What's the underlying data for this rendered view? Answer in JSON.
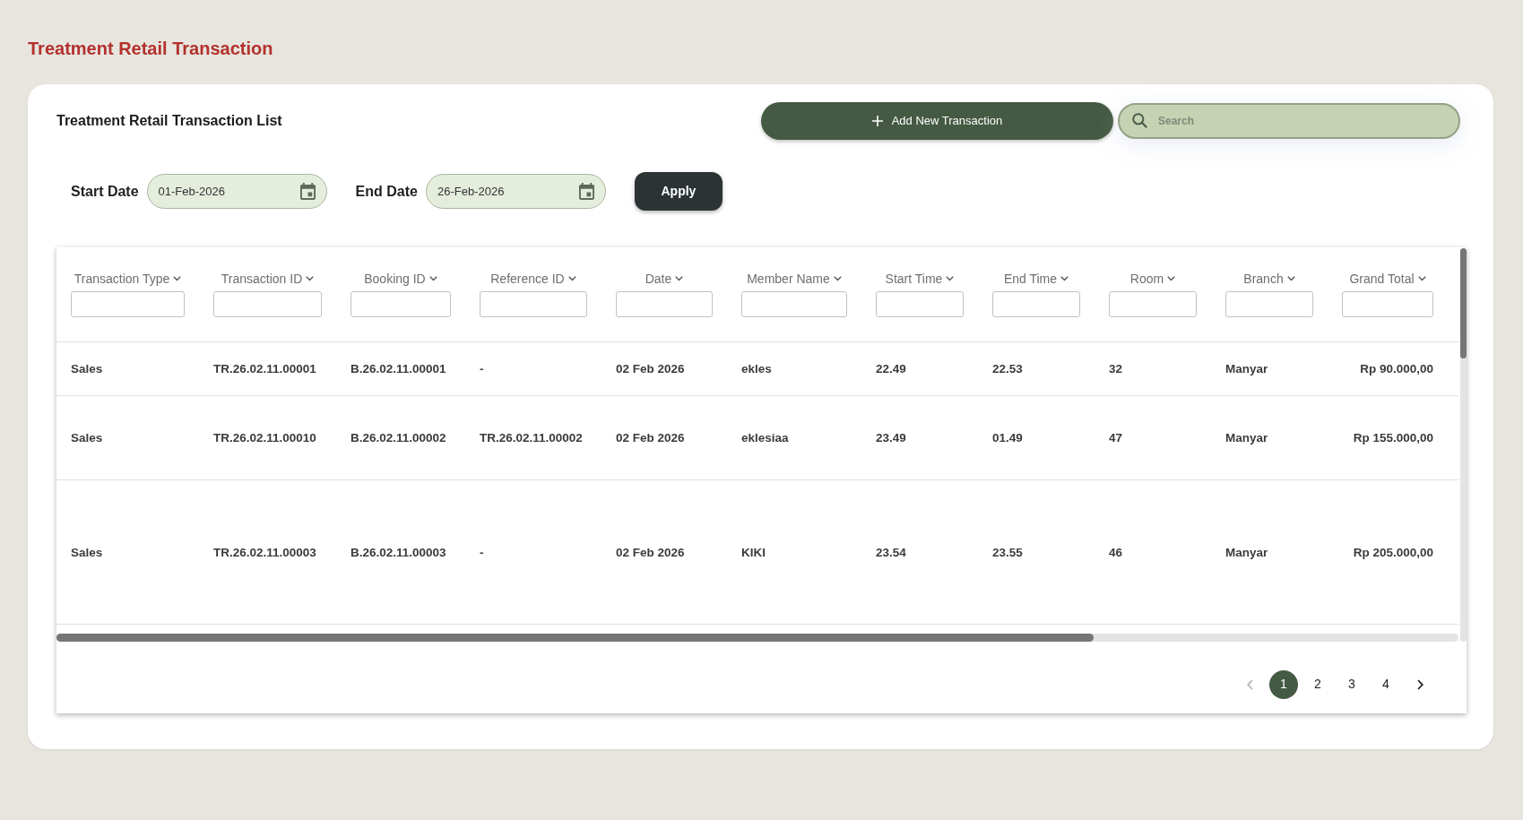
{
  "page_title": "Treatment Retail Transaction",
  "card": {
    "title": "Treatment Retail Transaction List",
    "add_button": {
      "label": "Add New Transaction"
    },
    "search": {
      "placeholder": "Search"
    }
  },
  "filters": {
    "start_date": {
      "label": "Start Date",
      "value": "01-Feb-2026"
    },
    "end_date": {
      "label": "End Date",
      "value": "26-Feb-2026"
    },
    "apply_button": {
      "label": "Apply"
    }
  },
  "table": {
    "columns": [
      {
        "label": "Transaction Type"
      },
      {
        "label": "Transaction ID"
      },
      {
        "label": "Booking ID"
      },
      {
        "label": "Reference ID"
      },
      {
        "label": "Date"
      },
      {
        "label": "Member Name"
      },
      {
        "label": "Start Time"
      },
      {
        "label": "End Time"
      },
      {
        "label": "Room"
      },
      {
        "label": "Branch"
      },
      {
        "label": "Grand Total"
      }
    ],
    "rows": [
      {
        "cells": [
          "Sales",
          "TR.26.02.11.00001",
          "B.26.02.11.00001",
          "-",
          "02 Feb 2026",
          "ekles",
          "22.49",
          "22.53",
          "32",
          "Manyar",
          "Rp 90.000,00"
        ]
      },
      {
        "cells": [
          "Sales",
          "TR.26.02.11.00010",
          "B.26.02.11.00002",
          "TR.26.02.11.00002",
          "02 Feb 2026",
          "eklesiaa",
          "23.49",
          "01.49",
          "47",
          "Manyar",
          "Rp 155.000,00"
        ]
      },
      {
        "cells": [
          "Sales",
          "TR.26.02.11.00003",
          "B.26.02.11.00003",
          "-",
          "02 Feb 2026",
          "KIKI",
          "23.54",
          "23.55",
          "46",
          "Manyar",
          "Rp 205.000,00"
        ]
      }
    ]
  },
  "pagination": {
    "previous": {
      "disabled": true
    },
    "pages": [
      {
        "label": "1",
        "selected": true
      },
      {
        "label": "2",
        "selected": false
      },
      {
        "label": "3",
        "selected": false
      },
      {
        "label": "4",
        "selected": false
      }
    ],
    "next": {
      "disabled": false
    }
  }
}
